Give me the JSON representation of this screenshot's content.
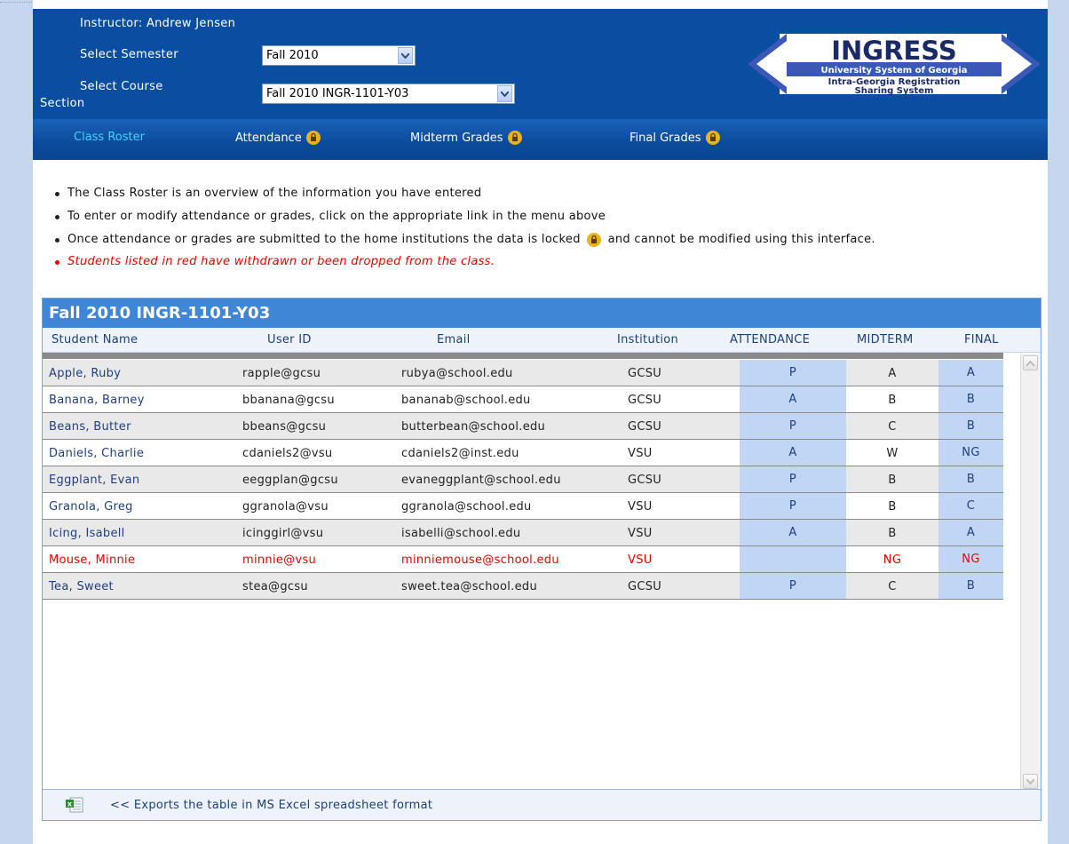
{
  "header": {
    "instructor_label": "Instructor: Andrew Jensen",
    "semester_label": "Select Semester",
    "semester_value": "Fall 2010",
    "course_label_line1": "Select Course",
    "course_label_line2": "Section",
    "course_value": "Fall 2010 INGR-1101-Y03"
  },
  "logo": {
    "title": "INGRESS",
    "line1": "University System of Georgia",
    "line2": "Intra-Georgia Registration",
    "line3": "Sharing System"
  },
  "nav": [
    {
      "label": "Class Roster",
      "active": true,
      "locked": false
    },
    {
      "label": "Attendance",
      "active": false,
      "locked": true
    },
    {
      "label": "Midterm Grades",
      "active": false,
      "locked": true
    },
    {
      "label": "Final Grades",
      "active": false,
      "locked": true
    }
  ],
  "notes": {
    "n1": "The Class Roster is an overview of the information you have entered",
    "n2": "To enter or modify attendance or grades, click on the appropriate link in the menu above",
    "n3a": "Once attendance or grades are submitted to the home institutions the data is locked",
    "n3b": "and cannot be modified using this interface.",
    "n4": "Students listed in red have withdrawn or been dropped from the class."
  },
  "table": {
    "title": "Fall 2010 INGR-1101-Y03",
    "columns": {
      "name": "Student Name",
      "uid": "User ID",
      "email": "Email",
      "inst": "Institution",
      "att": "ATTENDANCE",
      "mid": "MIDTERM",
      "fin": "FINAL"
    },
    "rows": [
      {
        "name": "Apple, Ruby",
        "uid": "rapple@gcsu",
        "email": "rubya@school.edu",
        "inst": "GCSU",
        "att": "P",
        "mid": "A",
        "fin": "A",
        "withdrawn": false
      },
      {
        "name": "Banana, Barney",
        "uid": "bbanana@gcsu",
        "email": "bananab@school.edu",
        "inst": "GCSU",
        "att": "A",
        "mid": "B",
        "fin": "B",
        "withdrawn": false
      },
      {
        "name": "Beans, Butter",
        "uid": "bbeans@gcsu",
        "email": "butterbean@school.edu",
        "inst": "GCSU",
        "att": "P",
        "mid": "C",
        "fin": "B",
        "withdrawn": false
      },
      {
        "name": "Daniels, Charlie",
        "uid": "cdaniels2@vsu",
        "email": "cdaniels2@inst.edu",
        "inst": "VSU",
        "att": "A",
        "mid": "W",
        "fin": "NG",
        "withdrawn": false
      },
      {
        "name": "Eggplant, Evan",
        "uid": "eeggplan@gcsu",
        "email": "evaneggplant@school.edu",
        "inst": "GCSU",
        "att": "P",
        "mid": "B",
        "fin": "B",
        "withdrawn": false
      },
      {
        "name": "Granola, Greg",
        "uid": "ggranola@vsu",
        "email": "ggranola@school.edu",
        "inst": "VSU",
        "att": "P",
        "mid": "B",
        "fin": "C",
        "withdrawn": false
      },
      {
        "name": "Icing, Isabell",
        "uid": "icinggirl@vsu",
        "email": "isabelli@school.edu",
        "inst": "VSU",
        "att": "A",
        "mid": "B",
        "fin": "A",
        "withdrawn": false
      },
      {
        "name": "Mouse, Minnie",
        "uid": "minnie@vsu",
        "email": "minniemouse@school.edu",
        "inst": "VSU",
        "att": "",
        "mid": "NG",
        "fin": "NG",
        "withdrawn": true
      },
      {
        "name": "Tea, Sweet",
        "uid": "stea@gcsu",
        "email": "sweet.tea@school.edu",
        "inst": "GCSU",
        "att": "P",
        "mid": "C",
        "fin": "B",
        "withdrawn": false
      }
    ]
  },
  "footer": {
    "export_label": "<< Exports the table in MS Excel spreadsheet format"
  },
  "colors": {
    "header_bg": "#0a4ea2",
    "active_nav": "#3fd5ff",
    "panel_title_bg": "#3f86d6",
    "grade_cell_bg": "#c0d6f4",
    "withdrawn_text": "#e00000"
  }
}
